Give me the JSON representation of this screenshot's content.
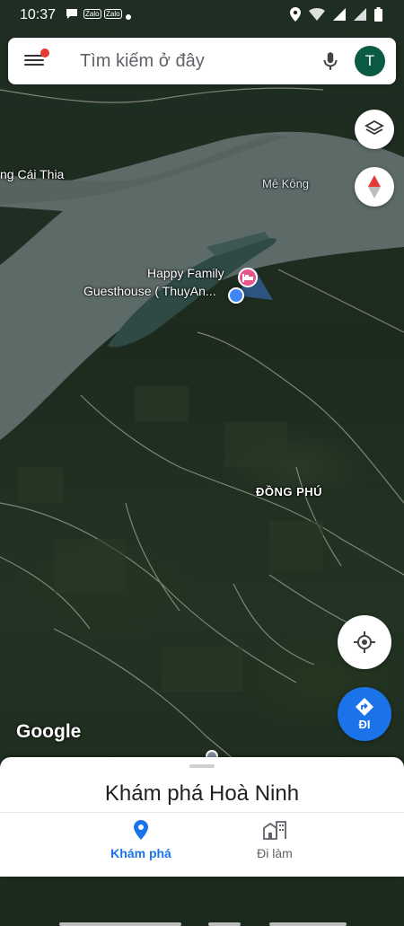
{
  "status_bar": {
    "time": "10:37",
    "notification_icons": [
      "chat-icon",
      "zalo-icon",
      "zalo-icon",
      "dot-icon"
    ],
    "zalo_label": "Zalo",
    "right_icons": [
      "location-icon",
      "wifi-icon",
      "signal-icon",
      "signal-icon",
      "battery-icon"
    ]
  },
  "search": {
    "placeholder": "Tìm kiếm ở đây",
    "avatar_letter": "T",
    "avatar_color": "#0b5a43"
  },
  "map": {
    "labels": {
      "cai_thia": "ng Cái Thia",
      "mekong": "Mê Kông",
      "guesthouse_line1": "Happy Family",
      "guesthouse_line2": "Guesthouse ( ThuyAn...",
      "dong_phu": "ĐỒNG PHÚ"
    },
    "google_logo": "Google",
    "go_label": "ĐI",
    "accent": "#1a73e8",
    "pin_color": "#e8548c"
  },
  "sheet": {
    "title": "Khám phá Hoà Ninh"
  },
  "nav": {
    "explore_label": "Khám phá",
    "work_label": "Đi làm"
  }
}
